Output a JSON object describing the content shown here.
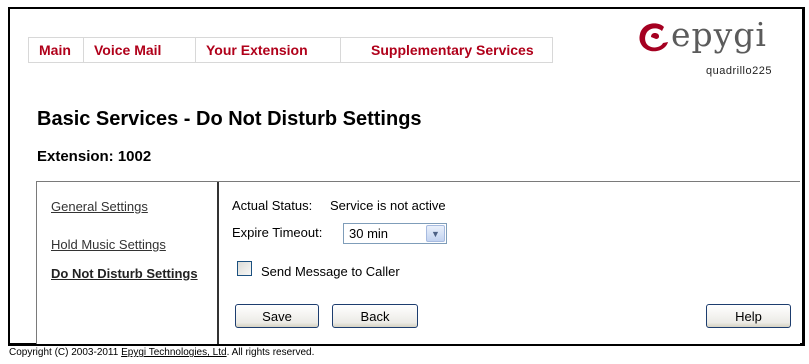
{
  "menu": {
    "items": [
      {
        "label": "Main"
      },
      {
        "label": "Voice Mail"
      },
      {
        "label": "Your Extension"
      },
      {
        "label": "Supplementary Services"
      }
    ]
  },
  "logo": {
    "word": "epygi",
    "model": "quadrillo225",
    "color": "#a50021"
  },
  "page": {
    "title": "Basic Services - Do Not Disturb Settings",
    "extension": "Extension: 1002"
  },
  "sidebar": {
    "items": [
      {
        "label": "General Settings"
      },
      {
        "label": "Hold Music Settings"
      },
      {
        "label": "Do Not Disturb Settings",
        "active": true
      }
    ]
  },
  "form": {
    "status_label": "Actual Status:",
    "status_value": "Service is not active",
    "expire_label": "Expire Timeout:",
    "expire_value": "30 min",
    "send_message_label": "Send Message to Caller",
    "send_message_checked": false
  },
  "buttons": {
    "save": "Save",
    "back": "Back",
    "help": "Help"
  },
  "footer": {
    "prefix": "Copyright (C) 2003-2011 ",
    "link": "Epygi Technologies, Ltd",
    "suffix": ". All rights reserved."
  }
}
